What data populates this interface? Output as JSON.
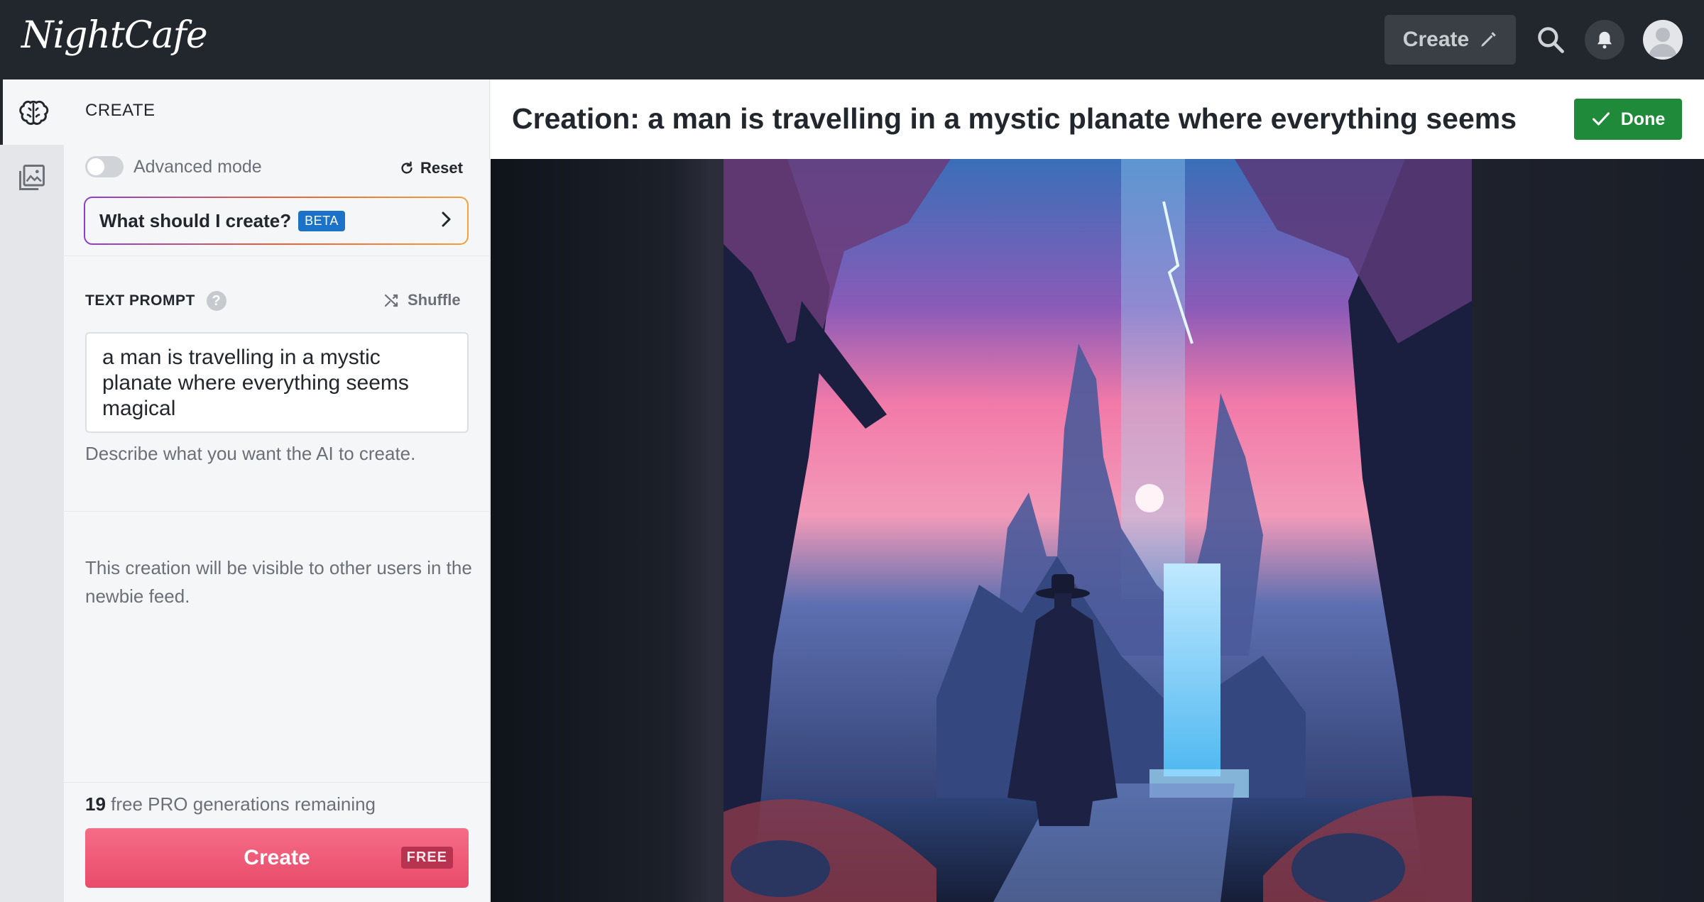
{
  "topbar": {
    "logo_text": "NightCafe",
    "create_label": "Create",
    "icons": [
      "pencil-icon",
      "search-icon",
      "bell-icon",
      "avatar"
    ]
  },
  "rail": {
    "items": [
      {
        "icon": "brain-icon",
        "active": true
      },
      {
        "icon": "gallery-icon",
        "active": false
      }
    ]
  },
  "panel": {
    "header": "CREATE",
    "advanced_mode_label": "Advanced mode",
    "advanced_mode_on": false,
    "reset_label": "Reset",
    "what_should_label": "What should I create?",
    "beta_badge": "BETA",
    "text_prompt_label": "TEXT PROMPT",
    "shuffle_label": "Shuffle",
    "prompt_value": "a man is travelling in a mystic planate where everything seems magical",
    "prompt_hint": "Describe what you want the AI to create.",
    "visibility_note": "This creation will be visible to other users in the newbie feed.",
    "remaining_count": "19",
    "remaining_text": "free PRO generations remaining",
    "create_button": "Create",
    "free_badge": "FREE"
  },
  "main": {
    "title": "Creation: a man is travelling in a mystic planate where everything seems m...",
    "done_label": "Done"
  },
  "colors": {
    "topbar": "#22272d",
    "create_button": "#ee5a78",
    "done_button": "#1f8a3a",
    "beta": "#1b72c7"
  }
}
